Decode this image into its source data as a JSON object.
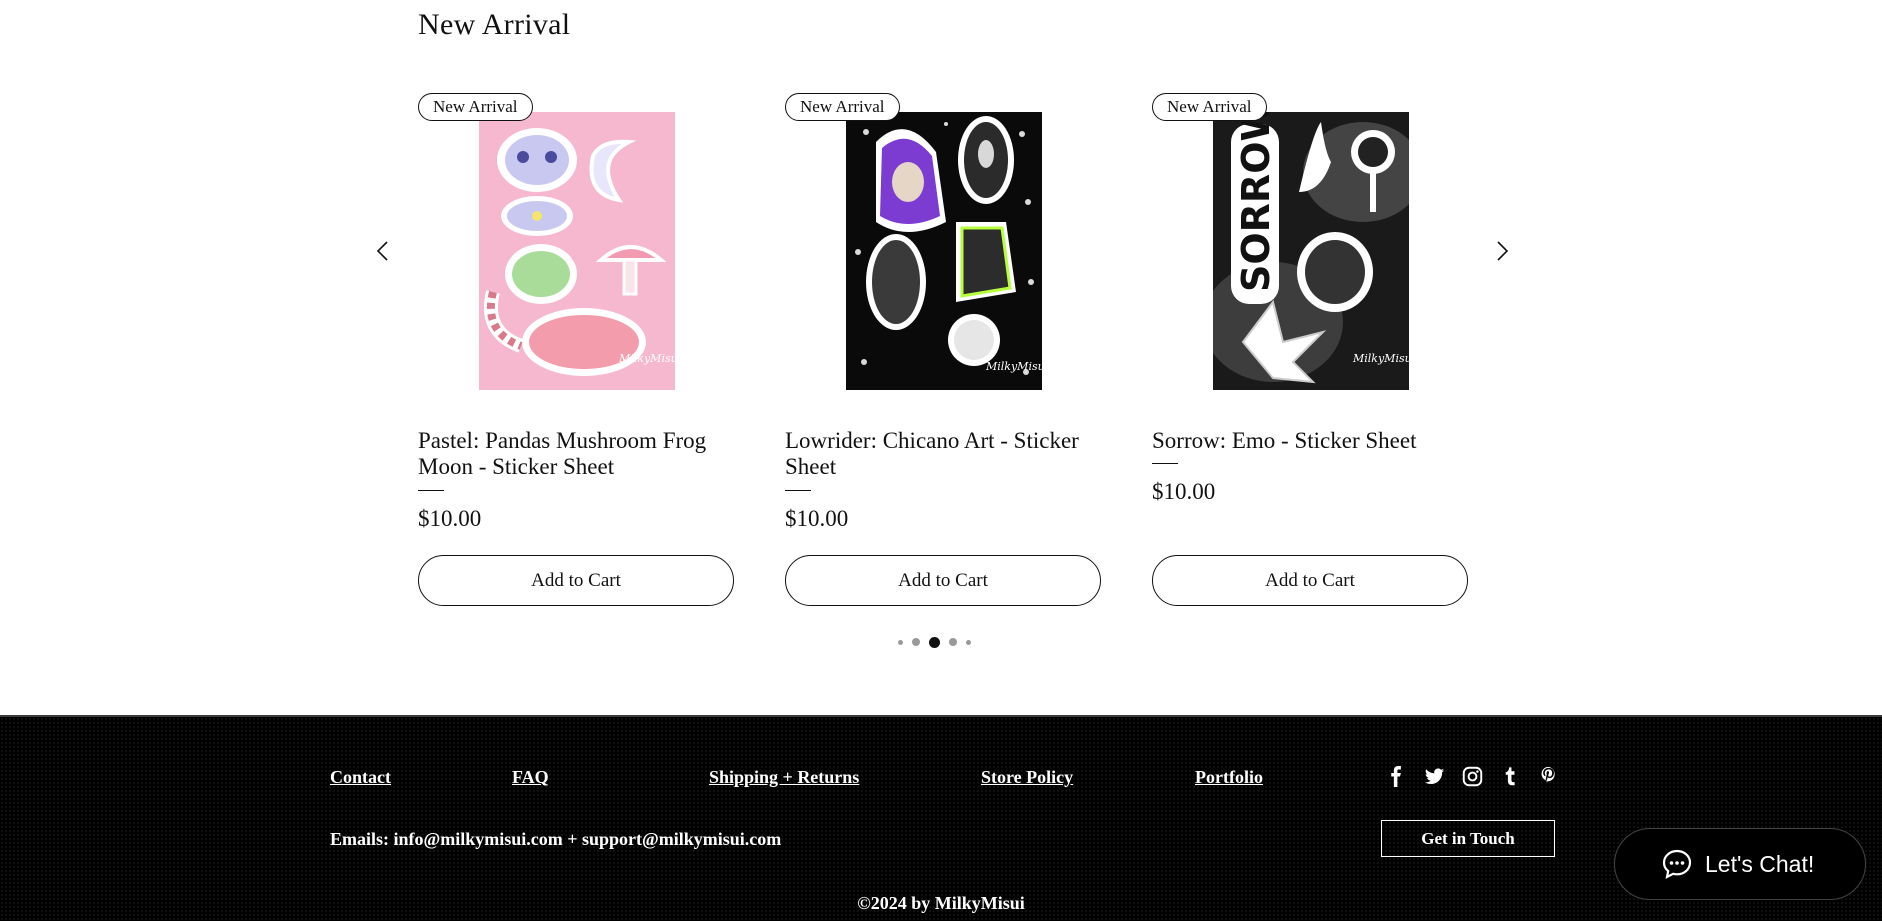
{
  "section": {
    "title": "New Arrival"
  },
  "carousel": {
    "prev_icon": "chevron-left-icon",
    "next_icon": "chevron-right-icon",
    "active_dot": 3,
    "dot_count": 5
  },
  "products": [
    {
      "badge": "New Arrival",
      "name": "Pastel: Pandas Mushroom Frog Moon - Sticker Sheet",
      "price": "$10.00",
      "cta": "Add to Cart",
      "image_theme": "pink"
    },
    {
      "badge": "New Arrival",
      "name": "Lowrider: Chicano Art - Sticker Sheet",
      "price": "$10.00",
      "cta": "Add to Cart",
      "image_theme": "black"
    },
    {
      "badge": "New Arrival",
      "name": "Sorrow: Emo - Sticker Sheet",
      "price": "$10.00",
      "cta": "Add to Cart",
      "image_theme": "bw"
    }
  ],
  "footer": {
    "links": [
      "Contact",
      "FAQ",
      "Shipping + Returns",
      "Store Policy",
      "Portfolio"
    ],
    "social_icons": [
      "facebook-icon",
      "twitter-icon",
      "instagram-icon",
      "tumblr-icon",
      "pinterest-icon"
    ],
    "emails": "Emails: info@milkymisui.com + support@milkymisui.com",
    "cta": "Get in Touch",
    "copyright": "©2024 by MilkyMisui"
  },
  "chat": {
    "label": "Let's Chat!",
    "icon": "chat-bubble-icon"
  },
  "colors": {
    "footer_bg": "#000000",
    "pink_sheet": "#f6b8cf",
    "accent_text": "#111111"
  }
}
